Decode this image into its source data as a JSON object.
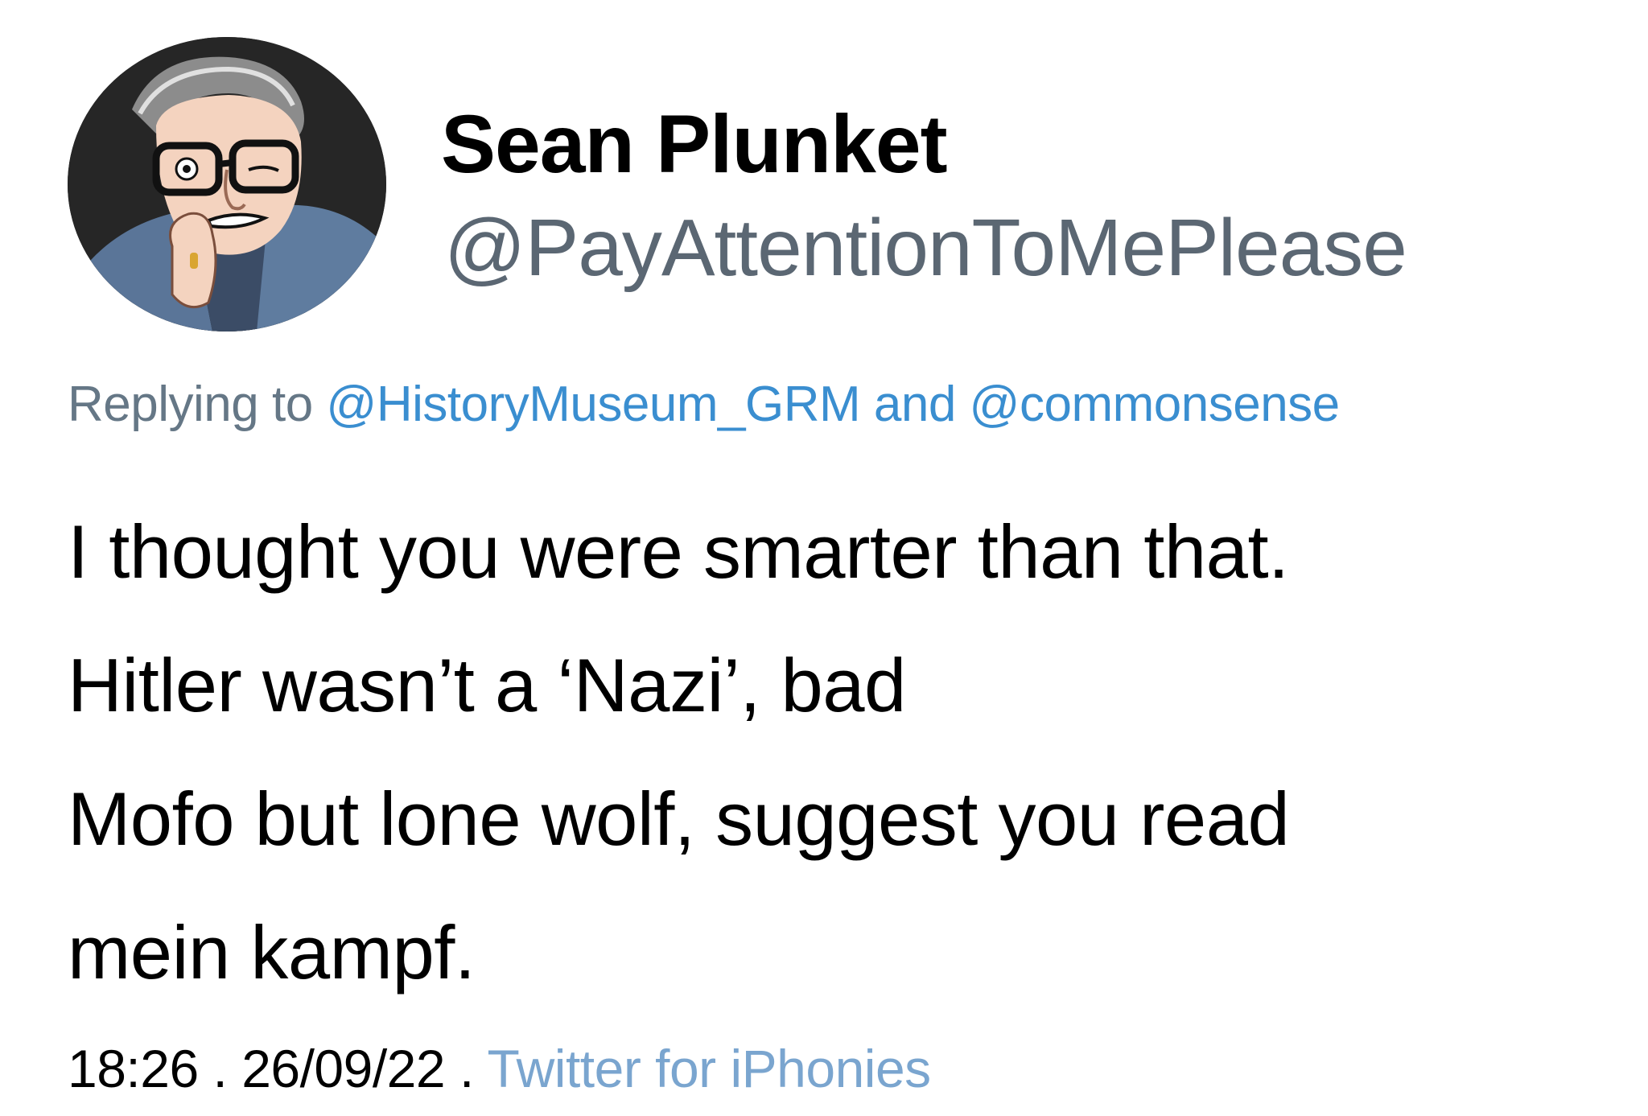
{
  "author": {
    "display_name": "Sean Plunket",
    "handle": "@PayAttentionToMePlease"
  },
  "reply": {
    "prefix": "Replying to ",
    "mention_1": "@HistoryMuseum_GRM",
    "conjunction": " and ",
    "mention_2": "@commonsense"
  },
  "tweet": {
    "lines": [
      "I thought you were smarter than that.",
      "Hitler wasn’t a ‘Nazi’, bad",
      "Mofo but lone wolf, suggest you read",
      "mein kampf."
    ]
  },
  "meta": {
    "time": "18:26",
    "separator_1": " . ",
    "date": "26/09/22",
    "separator_2": " . ",
    "source": "Twitter for iPhonies"
  },
  "colors": {
    "handle": "#5b6773",
    "reply_prefix": "#657786",
    "mention": "#3a8ed0",
    "source": "#7aa5cf"
  },
  "icons": {
    "avatar": "cartoon-man-avatar"
  }
}
